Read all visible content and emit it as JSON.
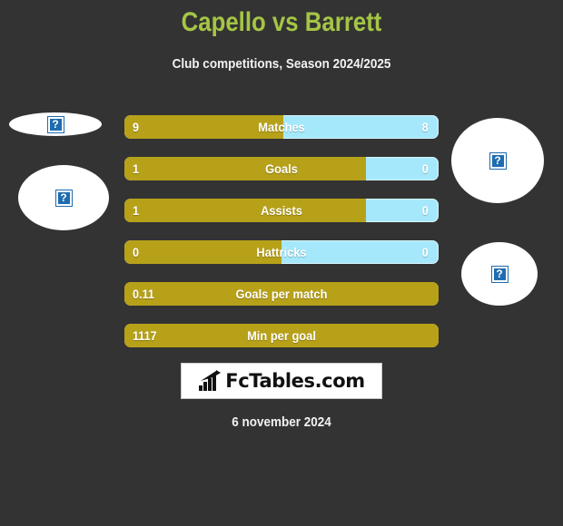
{
  "header": {
    "title": "Capello vs Barrett",
    "subtitle": "Club competitions, Season 2024/2025",
    "title_color": "#a5c545"
  },
  "colors": {
    "background": "#333333",
    "home_bar": "#b7a119",
    "away_bar": "#a5e8fb",
    "text": "#ffffff"
  },
  "avatars": {
    "left_top": {
      "icon": "broken-image-icon",
      "glyph": "?"
    },
    "left_main": {
      "icon": "broken-image-icon",
      "glyph": "?"
    },
    "right_top": {
      "icon": "broken-image-icon",
      "glyph": "?"
    },
    "right_main": {
      "icon": "broken-image-icon",
      "glyph": "?"
    }
  },
  "stats": [
    {
      "label": "Matches",
      "home": "9",
      "away": "8",
      "home_pct": 50.5,
      "split": true
    },
    {
      "label": "Goals",
      "home": "1",
      "away": "0",
      "home_pct": 76.8,
      "split": true
    },
    {
      "label": "Assists",
      "home": "1",
      "away": "0",
      "home_pct": 76.8,
      "split": true
    },
    {
      "label": "Hattricks",
      "home": "0",
      "away": "0",
      "home_pct": 50.0,
      "split": true
    },
    {
      "label": "Goals per match",
      "home": "0.11",
      "away": "",
      "home_pct": 100,
      "split": false
    },
    {
      "label": "Min per goal",
      "home": "1117",
      "away": "",
      "home_pct": 100,
      "split": false
    }
  ],
  "logo": {
    "text": "FcTables.com",
    "icon": "bar-chart-icon"
  },
  "footer": {
    "date": "6 november 2024"
  }
}
